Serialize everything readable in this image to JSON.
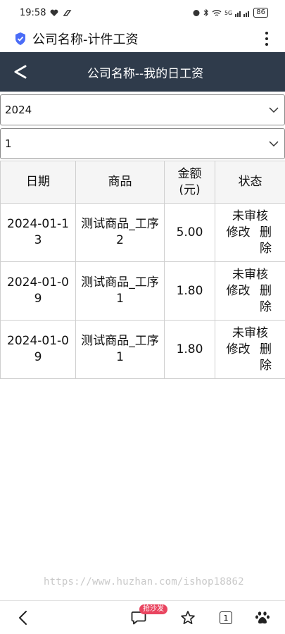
{
  "status_bar": {
    "time": "19:58",
    "battery": "86",
    "network": "5G"
  },
  "browser": {
    "title": "公司名称-计件工资"
  },
  "header": {
    "title": "公司名称--我的日工资"
  },
  "filters": {
    "year": "2024",
    "month": "1"
  },
  "table": {
    "headers": {
      "date": "日期",
      "goods": "商品",
      "amount": "金额\n(元)",
      "status": "状态"
    },
    "rows": [
      {
        "date": "2024-01-13",
        "goods": "测试商品_工序2",
        "amount": "5.00",
        "status": "未审核",
        "edit": "修改",
        "delete": "删除"
      },
      {
        "date": "2024-01-09",
        "goods": "测试商品_工序1",
        "amount": "1.80",
        "status": "未审核",
        "edit": "修改",
        "delete": "删除"
      },
      {
        "date": "2024-01-09",
        "goods": "测试商品_工序1",
        "amount": "1.80",
        "status": "未审核",
        "edit": "修改",
        "delete": "删除"
      }
    ]
  },
  "watermark": "https://www.huzhan.com/ishop18862",
  "bottom_nav": {
    "badge": "抢沙发",
    "tab_count": "1"
  },
  "colors": {
    "header_bg": "#2f3b4b",
    "badge_bg": "#e94560",
    "shield": "#4a6cf7"
  }
}
